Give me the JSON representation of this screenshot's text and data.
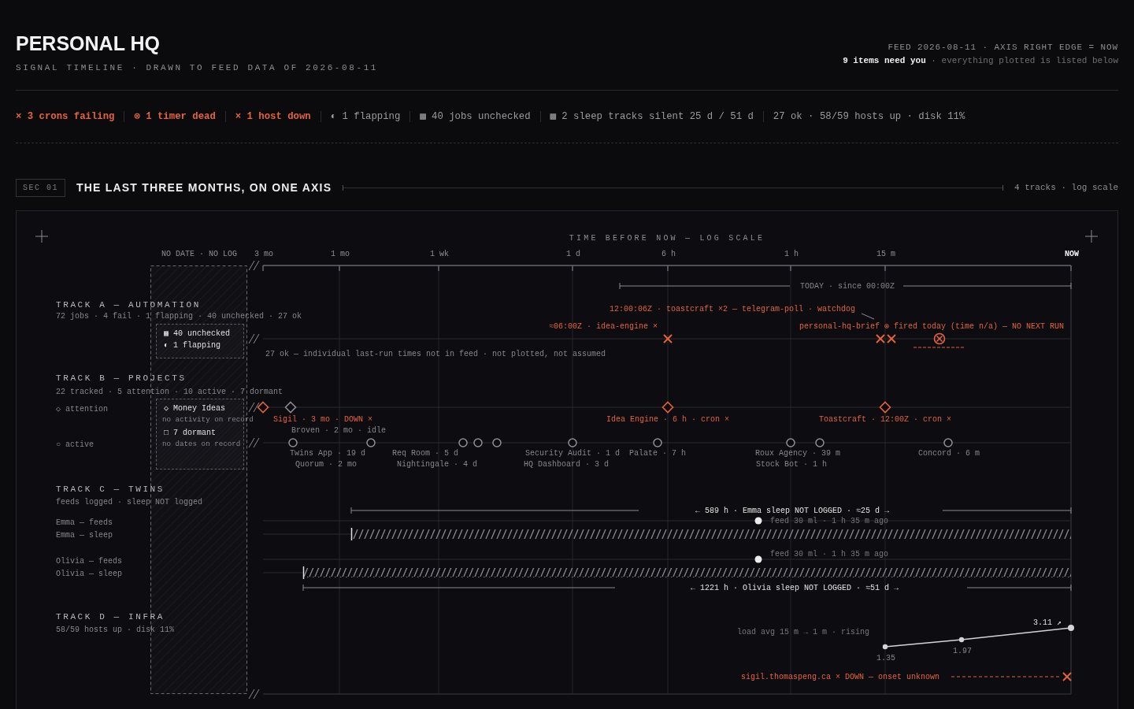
{
  "header": {
    "title": "PERSONAL HQ",
    "subtitle": "SIGNAL TIMELINE · DRAWN TO FEED DATA OF 2026-08-11",
    "feed_line": "FEED 2026-08-11 · AXIS RIGHT EDGE = NOW",
    "attention": "**9 items need you** · everything plotted is listed below"
  },
  "status_bar": [
    {
      "text": "× 3 crons failing",
      "kind": "alert"
    },
    {
      "text": "⊗ 1 timer dead",
      "kind": "alert"
    },
    {
      "text": "× 1 host down",
      "kind": "alert"
    },
    {
      "text": "◐ 1 flapping",
      "kind": "normal"
    },
    {
      "text": "▩ 40 jobs unchecked",
      "kind": "normal"
    },
    {
      "text": "▩ 2 sleep tracks silent 25 d / 51 d",
      "kind": "normal"
    },
    {
      "text": "27 ok · 58/59 hosts up · disk 11%",
      "kind": "normal"
    }
  ],
  "section": {
    "tag": "SEC 01",
    "title": "THE LAST THREE MONTHS, ON ONE AXIS",
    "meta": "4 tracks · log scale"
  },
  "timeline": {
    "axis": {
      "title": "TIME BEFORE NOW — LOG SCALE",
      "undated_label": "NO DATE · NO LOG",
      "ticks": [
        "3 mo",
        "1 mo",
        "1 wk",
        "1 d",
        "6 h",
        "1 h",
        "15 m",
        "NOW"
      ]
    },
    "tracks": [
      {
        "title": "TRACK A — AUTOMATION",
        "summary": "72 jobs · 4 fail · 1 flapping · 40 unchecked · 27 ok"
      },
      {
        "title": "TRACK B — PROJECTS",
        "summary": "22 tracked · 5 attention · 10 active · 7 dormant",
        "lanes": [
          "◇ attention",
          "○ active"
        ]
      },
      {
        "title": "TRACK C — TWINS",
        "summary": "feeds logged · sleep NOT logged",
        "lanes": [
          "Emma — feeds",
          "Emma — sleep",
          "Olivia — feeds",
          "Olivia — sleep"
        ]
      },
      {
        "title": "TRACK D — INFRA",
        "summary": "58/59 hosts up · disk 11%"
      }
    ],
    "undated": [
      {
        "items": [
          {
            "text": "▩ 40 unchecked"
          },
          {
            "text": "◐ 1 flapping"
          }
        ]
      },
      {
        "items": [
          {
            "text": "◇ Money Ideas",
            "note": "no activity on record"
          },
          {
            "text": "□ 7 dormant",
            "note": "no dates on record"
          }
        ]
      }
    ],
    "ranges": [
      "TODAY · since 00:00Z",
      "← 589 h · Emma sleep NOT LOGGED · ≈25 d →",
      "← 1221 h · Olivia sleep NOT LOGGED · ≈51 d →"
    ],
    "annotations": [
      {
        "text": "12:00:06Z · toastcraft ×2 — telegram-poll · watchdog",
        "kind": "alert"
      },
      {
        "text": "≈06:00Z · idea-engine ×",
        "kind": "alert"
      },
      {
        "text": "personal-hq-brief ⊗ fired today (time n/a) — NO NEXT RUN",
        "kind": "alert"
      },
      {
        "text": "27 ok — individual last-run times not in feed · not plotted, not assumed",
        "kind": "muted"
      },
      {
        "text": "Sigil · 3 mo · DOWN ×",
        "kind": "alert"
      },
      {
        "text": "Broven · 2 mo · idle",
        "kind": "muted"
      },
      {
        "text": "Idea Engine · 6 h · cron ×",
        "kind": "alert"
      },
      {
        "text": "Toastcraft · 12:00Z · cron ×",
        "kind": "alert"
      },
      {
        "text": "Twins App · 19 d",
        "kind": "muted"
      },
      {
        "text": "Quorum · 2 mo",
        "kind": "muted"
      },
      {
        "text": "Req Room · 5 d",
        "kind": "muted"
      },
      {
        "text": "Nightingale · 4 d",
        "kind": "muted"
      },
      {
        "text": "Security Audit · 1 d",
        "kind": "muted"
      },
      {
        "text": "HQ Dashboard · 3 d",
        "kind": "muted"
      },
      {
        "text": "Palate · 7 h",
        "kind": "muted"
      },
      {
        "text": "Roux Agency · 39 m",
        "kind": "muted"
      },
      {
        "text": "Stock Bot · 1 h",
        "kind": "muted"
      },
      {
        "text": "Concord · 6 m",
        "kind": "muted"
      },
      {
        "text": "feed 30 ml · 1 h 35 m ago",
        "kind": "dim"
      },
      {
        "text": "feed 30 ml · 1 h 35 m ago",
        "kind": "dim"
      },
      {
        "text": "load avg 15 m → 1 m · rising",
        "kind": "dim"
      },
      {
        "text": "sigil.thomaspeng.ca × DOWN — onset unknown",
        "kind": "alert"
      }
    ],
    "markers": [
      {
        "kind": "failed"
      },
      {
        "kind": "failed"
      },
      {
        "kind": "failed"
      },
      {
        "kind": "timer_dead"
      },
      {
        "kind": "diamond",
        "alert": true
      },
      {
        "kind": "diamond",
        "alert": false
      },
      {
        "kind": "diamond",
        "alert": true
      },
      {
        "kind": "diamond",
        "alert": true
      },
      {
        "kind": "circle"
      },
      {
        "kind": "circle"
      },
      {
        "kind": "circle"
      },
      {
        "kind": "circle"
      },
      {
        "kind": "circle"
      },
      {
        "kind": "circle"
      },
      {
        "kind": "circle"
      },
      {
        "kind": "circle"
      },
      {
        "kind": "circle"
      },
      {
        "kind": "circle"
      },
      {
        "kind": "feed"
      },
      {
        "kind": "feed"
      },
      {
        "kind": "silent"
      },
      {
        "kind": "silent"
      },
      {
        "kind": "down"
      }
    ],
    "load": {
      "kind": "sparkline",
      "point_labels": [
        "1.35",
        "1.97",
        "3.11 ↗"
      ]
    }
  }
}
